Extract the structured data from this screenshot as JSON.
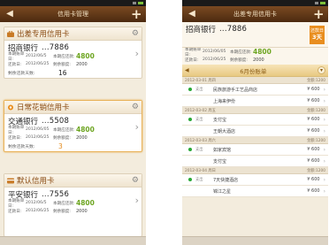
{
  "left": {
    "title": "信用卡管理",
    "cards": [
      {
        "category": "出差专用信用卡",
        "bank": "招商银行",
        "number": "...7886",
        "bill_date_label": "本期账单日:",
        "bill_date": "2012/06/5",
        "due_date_label": "还款日:",
        "due_date": "2012/06/25",
        "amount_label": "本期应还款:",
        "amount": "4800",
        "limit_label": "剩余额度:",
        "limit": "2000",
        "days_label": "剩余还款天数:",
        "days": "16"
      },
      {
        "category": "日常花销信用卡",
        "bank": "交通银行",
        "number": "...5508",
        "bill_date_label": "本期账单日:",
        "bill_date": "2012/06/05",
        "due_date_label": "还款日:",
        "due_date": "2012/06/25",
        "amount_label": "本期应还款:",
        "amount": "4800",
        "limit_label": "剩余额度:",
        "limit": "2000",
        "days_label": "剩余还款天数:",
        "days": "3"
      },
      {
        "category": "默认信用卡",
        "bank": "平安银行",
        "number": "...7556",
        "bill_date_label": "本期账单日:",
        "bill_date": "2012/06/5",
        "due_date_label": "还款日:",
        "due_date": "2012/06/25",
        "amount_label": "本期应还款:",
        "amount": "4800",
        "limit_label": "剩余额度:",
        "limit": "2000"
      }
    ]
  },
  "right": {
    "title": "出差专用信用卡",
    "bank": "招商银行",
    "number": "...7886",
    "bill_date_label": "本期账单日:",
    "bill_date": "2012/06/05",
    "due_date_label": "还款日:",
    "due_date": "2012/06/25",
    "amount_label": "本期应还款:",
    "amount": "4800",
    "limit_label": "剩余额度:",
    "limit": "2000",
    "badge_top": "还款日",
    "badge_days": "3天",
    "month_title": "6月份账单",
    "groups": [
      {
        "date": "2012-03-01 周四",
        "balance": "金额:1200",
        "items": [
          {
            "type": "支出",
            "merchant": "民族旅游手工艺品商店",
            "amount": "¥ 600",
            "dot": true
          },
          {
            "type": "",
            "merchant": "上海来伊份",
            "amount": "¥ 600",
            "dot": false
          }
        ]
      },
      {
        "date": "2012-03-02 周五",
        "balance": "金额:1200",
        "items": [
          {
            "type": "支出",
            "merchant": "支付宝",
            "amount": "¥ 600",
            "dot": true
          },
          {
            "type": "",
            "merchant": "王朝大酒店",
            "amount": "¥ 600",
            "dot": false
          }
        ]
      },
      {
        "date": "2012-03-03 周六",
        "balance": "金额:1200",
        "items": [
          {
            "type": "支出",
            "merchant": "如家宾馆",
            "amount": "¥ 600",
            "dot": true
          },
          {
            "type": "",
            "merchant": "支付宝",
            "amount": "¥ 600",
            "dot": false
          }
        ]
      },
      {
        "date": "2012-03-04 周日",
        "balance": "金额:1200",
        "items": [
          {
            "type": "支出",
            "merchant": "7天快捷酒店",
            "amount": "¥ 600",
            "dot": true
          },
          {
            "type": "",
            "merchant": "锦江之星",
            "amount": "¥ 600",
            "dot": false
          }
        ]
      }
    ]
  }
}
